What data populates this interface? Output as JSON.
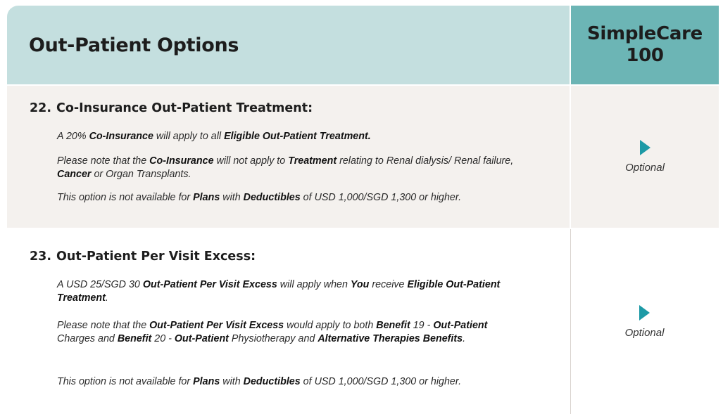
{
  "header": {
    "title": "Out-Patient Options",
    "plan_line1": "SimpleCare",
    "plan_line2": "100"
  },
  "sections": [
    {
      "number": "22.",
      "title": "Co-Insurance Out-Patient Treatment:",
      "status": "Optional",
      "status_icon": "play-triangle-icon",
      "p1": {
        "t1": "A 20% ",
        "b1": "Co-Insurance",
        "t2": " will apply to all ",
        "b2": "Eligible Out-Patient Treatment."
      },
      "p2": {
        "t1": "Please note that the ",
        "b1": "Co-Insurance",
        "t2": " will not apply to ",
        "b2": "Treatment",
        "t3": " relating to Renal dialysis/ Renal failure, ",
        "b3": "Cancer",
        "t4": " or Organ Transplants."
      },
      "p3": {
        "t1": "This option is not available for ",
        "b1": "Plans",
        "t2": " with ",
        "b2": "Deductibles",
        "t3": " of  USD 1,000/SGD 1,300 or higher."
      }
    },
    {
      "number": "23.",
      "title": "Out-Patient Per Visit Excess:",
      "status": "Optional",
      "status_icon": "play-triangle-icon",
      "p1": {
        "t1": "A USD 25/SGD 30 ",
        "b1": "Out-Patient Per Visit Excess",
        "t2": " will apply when ",
        "b2": "You",
        "t3": " receive ",
        "b3": "Eligible Out-Patient Treatment",
        "t4": "."
      },
      "p2": {
        "t1": "Please note that the ",
        "b1": "Out-Patient Per Visit Excess",
        "t2": " would apply to both ",
        "b2": "Benefit",
        "t3": " 19 - ",
        "b3": "Out-Patient",
        "t4": " Charges and  ",
        "b4": "Benefit",
        "t5": " 20 - ",
        "b5": "Out-Patient",
        "t6": " Physiotherapy and ",
        "b6": "Alternative Therapies Benefits",
        "t7": "."
      },
      "p3": {
        "t1": "This option is not available for ",
        "b1": "Plans",
        "t2": " with ",
        "b2": "Deductibles",
        "t3": " of  USD 1,000/SGD 1,300 or higher."
      }
    }
  ],
  "colors": {
    "header_left": "#c4dfdf",
    "header_right": "#6cb5b5",
    "row_shaded": "#f4f1ee",
    "arrow": "#1d9aa6"
  }
}
